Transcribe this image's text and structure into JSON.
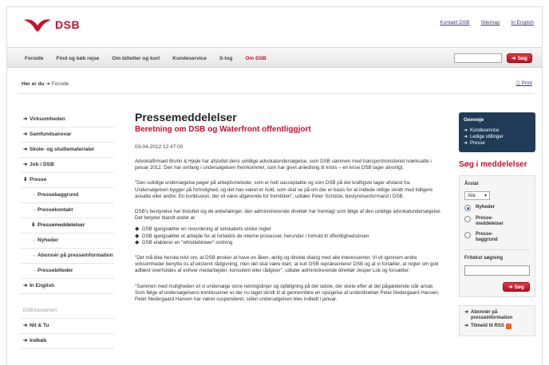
{
  "header": {
    "logo_text": "DSB",
    "top_links": [
      "Kontakt DSB",
      "Sitemap",
      "In English"
    ]
  },
  "nav": {
    "items": [
      "Forside",
      "Find og køb rejse",
      "Om billetter og kort",
      "Kundeservice",
      "S-tog",
      "Om DSB"
    ],
    "active_index": 5,
    "search_button": "Søg"
  },
  "breadcrumb": {
    "label": "Her er du",
    "item": "Forside"
  },
  "print_label": "Print",
  "sidebar": {
    "items": [
      {
        "label": "Virksomheden",
        "level": 0
      },
      {
        "label": "Samfundsansvar",
        "level": 0
      },
      {
        "label": "Skole- og studiematerialer",
        "level": 0
      },
      {
        "label": "Job i DSB",
        "level": 0
      },
      {
        "label": "Presse",
        "level": 0
      },
      {
        "label": "Pressebaggrund",
        "level": 1
      },
      {
        "label": "Pressekontakt",
        "level": 1
      },
      {
        "label": "Pressemeddelelser",
        "level": 1
      },
      {
        "label": "Nyheder",
        "level": 1
      },
      {
        "label": "Abonnér på presseinformation",
        "level": 1
      },
      {
        "label": "Pressebilleder",
        "level": 1
      },
      {
        "label": "In English",
        "level": 0
      }
    ],
    "group_label": "DSB koncernen",
    "group_items": [
      "Nit & Tu",
      "Indkøb"
    ]
  },
  "main": {
    "title": "Pressemeddelelser",
    "subtitle": "Beretning om DSB og Waterfront offentliggjort",
    "date": "03-04-2012 12:47:00",
    "para1": "Advokatfirmaet Bruhn & Hjejle har afsluttet dens uvildige advokatundersøgelse, som DSB sammen med transportministeriet iværksatte i januar 2012. Den har omfang i undersøgelsen fremkommet, som har givet anledning til krisis – en krise DSB tager alvorligt.",
    "para2": "\"Den uvildige undersøgelse peger på arbejdsmetoder, som er helt uacceptable og som DSB på det kraftigste tager afstand fra. Undersøgelsen bygger på fortrolighed, og det han været et hold, som skal se på om der er basis for at indlede retlige skridt mod tidligere ansatte eller andre. En konklusion, der vil være afgørende for fremtiden\", udtaler Peter Schütze, bestyrelsesformand i DSB.",
    "para3": "DSB's bestyrelse har tilsluttet sig de anbefalinger, den administrerende direktør har fremlagt som følge af den uvildige advokatundersøgelse. Det betyder blandt andet at:",
    "bullets": [
      "DSB igangsætter en revurdering af selskabets etiske regler",
      "DSB igangsætter et arbejde for at forbedre de interne processer, herunder i forhold til offentlighedsloven",
      "DSB etablerer en \"whistleblower\"-ordning"
    ],
    "para4": "\"Det må ikke herske tvivl om, at DSB ønsker at have en åben, ærlig og direkte dialog med alle interessenter. Vi vil igennem andre virksomheder benytte os af eksternt rådgivning, men det skal være klart, at kun DSB repræsenterer DSB og at vi fortæller, at regler om god adfærd overholdes af enhver medarbejder, konsulent eller rådgiver\", udtaler administrerende direktør Jesper Lok og forsætter:",
    "para5": "\"Sammen med muligheden vil vi undersøge store retningslinjer og opfølgning på det sidste, der skete efter at det pågældende står ansat. Som følge af undersøgelsens konklusioner er der nu taget skridt til at gennemføre en opsigelse af underdirektør Peter Nedergaard Hansen. Peter Nedergaard Hansen har været suspenderet, siden undersøgelsen blev indledt i januar."
  },
  "right": {
    "genveje_title": "Genveje",
    "genveje_links": [
      "Kundeservice",
      "Ledige stillinger",
      "Presse"
    ],
    "search_title": "Søg i meddelelser",
    "year_label": "Årstal",
    "year_value": "Alle",
    "radios": [
      {
        "label": "Nyheder",
        "checked": true
      },
      {
        "label": "Presse-meddelelser",
        "checked": false
      },
      {
        "label": "Presse-baggrund",
        "checked": false
      }
    ],
    "free_search_label": "Fritekst søgning",
    "search_button": "Søg",
    "abonner_links": [
      "Abonnér på presseinformation",
      "Tilmeld til RSS"
    ]
  },
  "colors": {
    "brand_red": "#c8102e",
    "genveje_bg": "#1f3b57",
    "link_blue": "#3a3a8a"
  }
}
